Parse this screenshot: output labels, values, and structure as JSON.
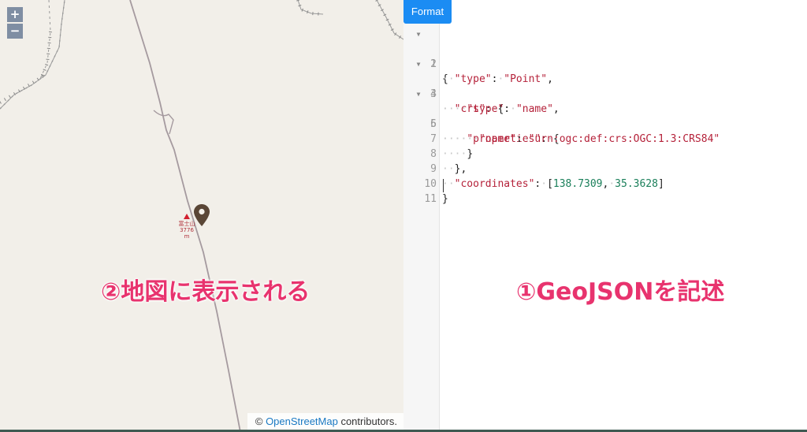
{
  "map": {
    "zoom_in_label": "+",
    "zoom_out_label": "−",
    "peak_name": "富士山",
    "peak_elevation": "3776 m",
    "attribution_prefix": "© ",
    "attribution_link": "OpenStreetMap",
    "attribution_suffix": " contributors.",
    "annotation": "②地図に表示される"
  },
  "editor": {
    "format_button": "Format",
    "annotation": "①GeoJSONを記述",
    "lines": [
      {
        "num": "1",
        "fold": true
      },
      {
        "num": "2",
        "fold": false
      },
      {
        "num": "3",
        "fold": true
      },
      {
        "num": "4",
        "fold": false
      },
      {
        "num": "5",
        "fold": true
      },
      {
        "num": "6",
        "fold": false
      },
      {
        "num": "7",
        "fold": false
      },
      {
        "num": "8",
        "fold": false
      },
      {
        "num": "9",
        "fold": false
      },
      {
        "num": "10",
        "fold": false
      },
      {
        "num": "11",
        "fold": false
      }
    ],
    "geojson": {
      "key_type": "\"type\"",
      "val_point": "\"Point\"",
      "key_crs": "\"crs\"",
      "val_name": "\"name\"",
      "key_properties": "\"properties\"",
      "key_name": "\"name\"",
      "val_urn": "\"urn:ogc:def:crs:OGC:1.3:CRS84\"",
      "key_coordinates": "\"coordinates\"",
      "lng": "138.7309",
      "lat": "35.3628"
    }
  },
  "colors": {
    "map_background": "#f2efe9",
    "accent": "#1b8cf3",
    "annotation": "#e8336e",
    "marker": "#5a4636"
  }
}
